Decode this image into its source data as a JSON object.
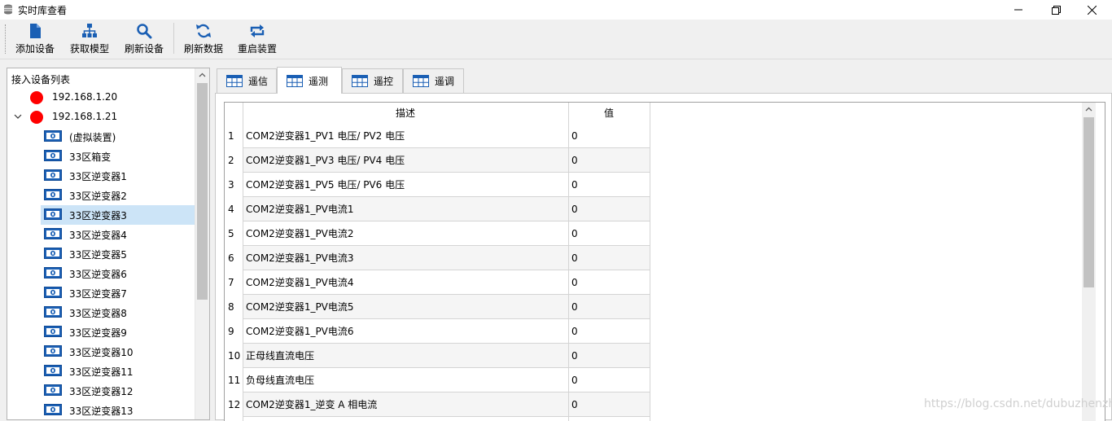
{
  "window": {
    "title": "实时库查看",
    "icons": [
      "database-icon",
      "minimize-icon",
      "maximize-icon",
      "close-icon"
    ]
  },
  "toolbar": {
    "add_device": "添加设备",
    "get_model": "获取模型",
    "refresh_device": "刷新设备",
    "refresh_data": "刷新数据",
    "restart_device": "重启装置"
  },
  "tree": {
    "header": "接入设备列表",
    "hosts": [
      {
        "label": "192.168.1.20",
        "status_color": "#ff0000",
        "expanded": false
      },
      {
        "label": "192.168.1.21",
        "status_color": "#ff0000",
        "expanded": true
      }
    ],
    "devices": [
      "(虚拟装置)",
      "33区箱变",
      "33区逆变器1",
      "33区逆变器2",
      "33区逆变器3",
      "33区逆变器4",
      "33区逆变器5",
      "33区逆变器6",
      "33区逆变器7",
      "33区逆变器8",
      "33区逆变器9",
      "33区逆变器10",
      "33区逆变器11",
      "33区逆变器12",
      "33区逆变器13"
    ],
    "selected": "33区逆变器3"
  },
  "tabs": [
    {
      "label": "遥信",
      "active": false
    },
    {
      "label": "遥测",
      "active": true
    },
    {
      "label": "遥控",
      "active": false
    },
    {
      "label": "遥调",
      "active": false
    }
  ],
  "table": {
    "headers": {
      "desc": "描述",
      "value": "值"
    },
    "rows": [
      {
        "num": "1",
        "desc": "COM2逆变器1_PV1 电压/ PV2 电压",
        "value": "0"
      },
      {
        "num": "2",
        "desc": "COM2逆变器1_PV3 电压/ PV4 电压",
        "value": "0"
      },
      {
        "num": "3",
        "desc": "COM2逆变器1_PV5 电压/ PV6 电压",
        "value": "0"
      },
      {
        "num": "4",
        "desc": "COM2逆变器1_PV电流1",
        "value": "0"
      },
      {
        "num": "5",
        "desc": "COM2逆变器1_PV电流2",
        "value": "0"
      },
      {
        "num": "6",
        "desc": "COM2逆变器1_PV电流3",
        "value": "0"
      },
      {
        "num": "7",
        "desc": "COM2逆变器1_PV电流4",
        "value": "0"
      },
      {
        "num": "8",
        "desc": "COM2逆变器1_PV电流5",
        "value": "0"
      },
      {
        "num": "9",
        "desc": "COM2逆变器1_PV电流6",
        "value": "0"
      },
      {
        "num": "10",
        "desc": "正母线直流电压",
        "value": "0"
      },
      {
        "num": "11",
        "desc": "负母线直流电压",
        "value": "0"
      },
      {
        "num": "12",
        "desc": "COM2逆变器1_逆变 A 相电流",
        "value": "0"
      }
    ]
  },
  "watermark": "https://blog.csdn.net/dubuzhenzhu",
  "colors": {
    "toolbar_icon": "#1a5fb4",
    "status_dot": "#ff0000",
    "selection": "#cce4f7",
    "alt_row": "#f5f5f5"
  }
}
